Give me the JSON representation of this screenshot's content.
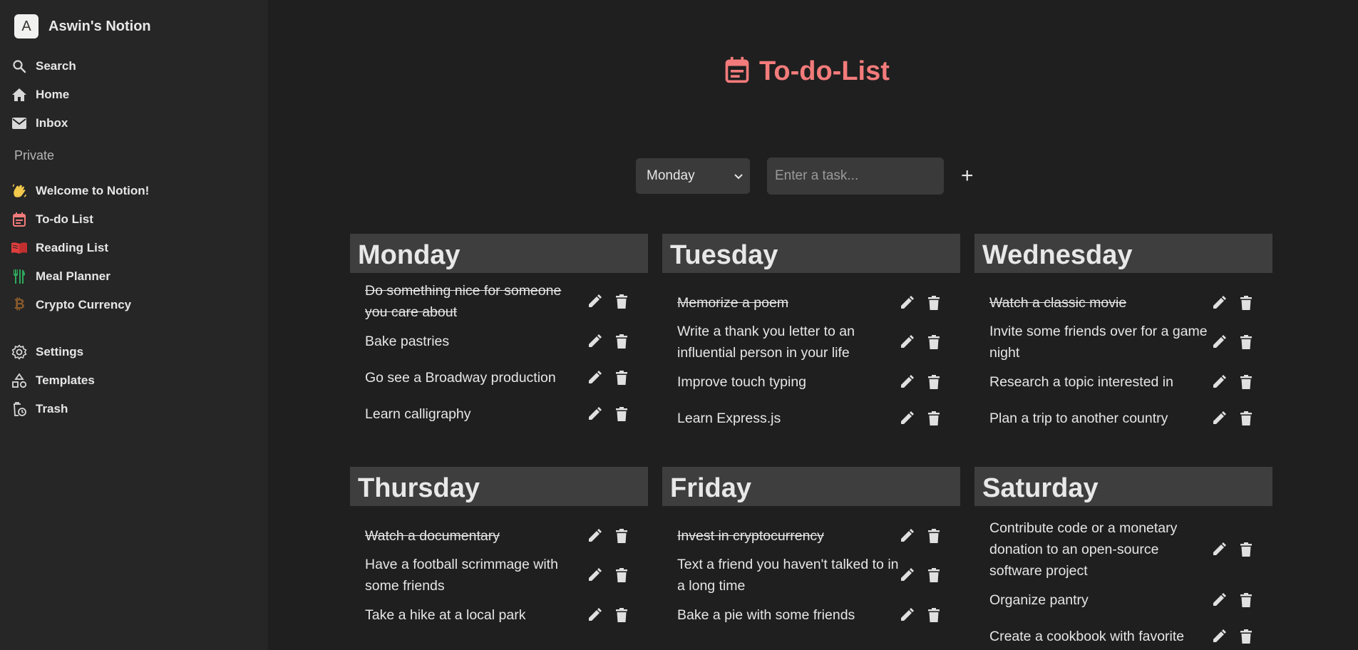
{
  "workspace": {
    "avatar_letter": "A",
    "name": "Aswin's Notion"
  },
  "nav": {
    "search": "Search",
    "home": "Home",
    "inbox": "Inbox"
  },
  "private_label": "Private",
  "pages": [
    {
      "label": "Welcome to Notion!",
      "icon": "waving-hand-icon",
      "color": "#f2c94c"
    },
    {
      "label": "To-do List",
      "icon": "calendar-icon",
      "color": "#f47b7b"
    },
    {
      "label": "Reading List",
      "icon": "book-icon",
      "color": "#e03e3e"
    },
    {
      "label": "Meal Planner",
      "icon": "utensils-icon",
      "color": "#2eaa5c"
    },
    {
      "label": "Crypto Currency",
      "icon": "bitcoin-icon",
      "color": "#8a5a2b"
    }
  ],
  "footer_nav": {
    "settings": "Settings",
    "templates": "Templates",
    "trash": "Trash"
  },
  "main": {
    "title": "To-do-List",
    "title_color": "#f47b7b",
    "day_select": "Monday",
    "task_placeholder": "Enter a task...",
    "add_symbol": "+"
  },
  "days": [
    {
      "name": "Monday",
      "tasks": [
        {
          "text": "Do something nice for someone you care about",
          "done": true
        },
        {
          "text": "Bake pastries",
          "done": false
        },
        {
          "text": "Go see a Broadway production",
          "done": false
        },
        {
          "text": "Learn calligraphy",
          "done": false
        }
      ]
    },
    {
      "name": "Tuesday",
      "tasks": [
        {
          "text": "Memorize a poem",
          "done": true
        },
        {
          "text": "Write a thank you letter to an influential person in your life",
          "done": false
        },
        {
          "text": "Improve touch typing",
          "done": false
        },
        {
          "text": "Learn Express.js",
          "done": false
        }
      ]
    },
    {
      "name": "Wednesday",
      "tasks": [
        {
          "text": "Watch a classic movie",
          "done": true
        },
        {
          "text": "Invite some friends over for a game night",
          "done": false
        },
        {
          "text": "Research a topic interested in",
          "done": false
        },
        {
          "text": "Plan a trip to another country",
          "done": false
        }
      ]
    },
    {
      "name": "Thursday",
      "tasks": [
        {
          "text": "Watch a documentary",
          "done": true
        },
        {
          "text": "Have a football scrimmage with some friends",
          "done": false
        },
        {
          "text": "Take a hike at a local park",
          "done": false
        }
      ]
    },
    {
      "name": "Friday",
      "tasks": [
        {
          "text": "Invest in cryptocurrency",
          "done": true
        },
        {
          "text": "Text a friend you haven't talked to in a long time",
          "done": false
        },
        {
          "text": "Bake a pie with some friends",
          "done": false
        }
      ]
    },
    {
      "name": "Saturday",
      "tasks": [
        {
          "text": "Contribute code or a monetary donation to an open-source software project",
          "done": false
        },
        {
          "text": "Organize pantry",
          "done": false
        },
        {
          "text": "Create a cookbook with favorite",
          "done": false
        }
      ]
    }
  ]
}
